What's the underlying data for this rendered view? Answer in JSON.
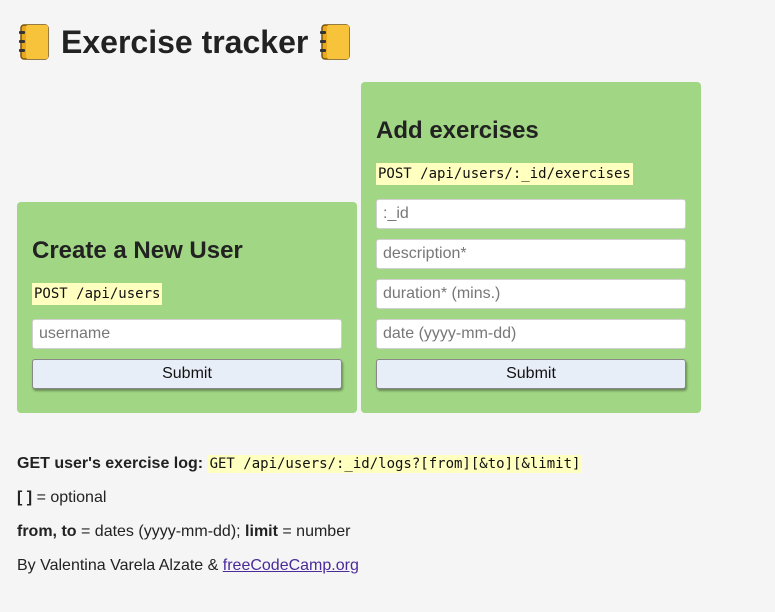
{
  "header": {
    "title": "Exercise tracker",
    "icon_left": "notebook-icon",
    "icon_right": "notebook-icon"
  },
  "create_user": {
    "heading": "Create a New User",
    "endpoint": "POST /api/users",
    "username_placeholder": "username",
    "username_value": "",
    "submit_label": "Submit"
  },
  "add_exercise": {
    "heading": "Add exercises",
    "endpoint": "POST /api/users/:_id/exercises",
    "id_placeholder": ":_id",
    "description_placeholder": "description*",
    "duration_placeholder": "duration* (mins.)",
    "date_placeholder": "date (yyyy-mm-dd)",
    "submit_label": "Submit"
  },
  "info": {
    "log_label": "GET user's exercise log:",
    "log_endpoint": "GET /api/users/:_id/logs?[from][&to][&limit]",
    "optional_bracket": "[ ]",
    "optional_text": "= optional",
    "from_to_label": "from, to",
    "from_to_text": "= dates (yyyy-mm-dd);",
    "limit_label": "limit",
    "limit_text": "= number",
    "credit_text": "By Valentina Varela Alzate &",
    "credit_link": "freeCodeCamp.org"
  },
  "colors": {
    "card_bg": "#a1d684",
    "code_bg": "#ffffc0",
    "page_bg": "#f5f5f5",
    "link": "#4b2a9a"
  }
}
